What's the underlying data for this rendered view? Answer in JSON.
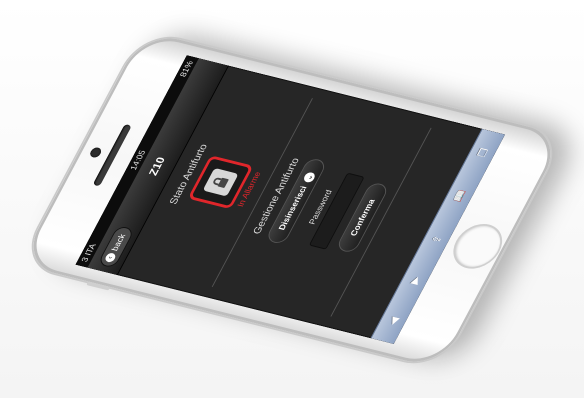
{
  "status_bar": {
    "carrier": "3 ITA",
    "time": "14:05",
    "battery": "81%"
  },
  "nav": {
    "back_label": "back",
    "back_icon": "back-arrow-icon",
    "title": "Z10"
  },
  "alarm": {
    "section_title": "Stato Antifurto",
    "status_icon": "lock-icon",
    "status_text": "In Allarme",
    "accent_color": "#e0262b"
  },
  "management": {
    "section_title": "Gestione Antifurto",
    "select_value": "Disinserisci",
    "password_label": "Password",
    "password_value": "",
    "confirm_label": "Conferma"
  },
  "safari_toolbar": {
    "icons": [
      "back-arrow-icon",
      "forward-arrow-icon",
      "share-icon",
      "bookmarks-icon",
      "tabs-icon"
    ]
  }
}
